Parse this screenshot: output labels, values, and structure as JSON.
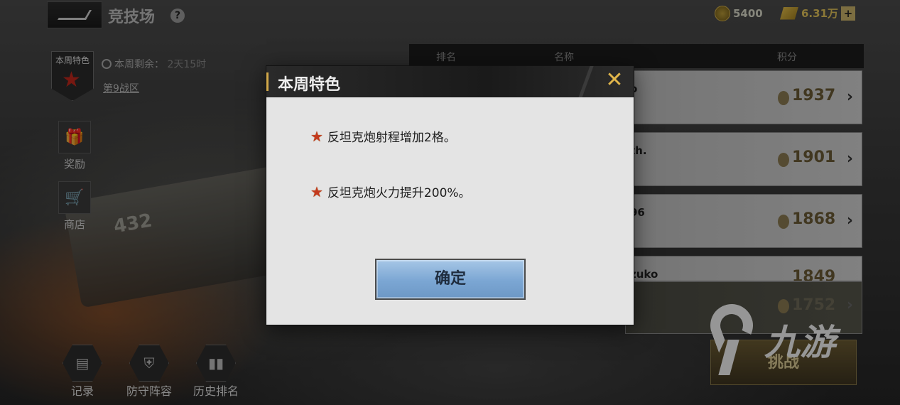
{
  "header": {
    "title": "竞技场",
    "help_icon": "?",
    "currency_1": "5400",
    "currency_2": "6.31万",
    "plus": "+"
  },
  "weekly": {
    "badge_label": "本周特色",
    "remaining_label": "本周剩余：",
    "remaining_value": "2天15时",
    "zone": "第9战区"
  },
  "side_menu": [
    {
      "label": "奖励",
      "icon": "gift-icon"
    },
    {
      "label": "商店",
      "icon": "shop-icon"
    }
  ],
  "bottom_menu": [
    {
      "label": "记录",
      "icon": "record-icon"
    },
    {
      "label": "防守阵容",
      "icon": "shield-icon"
    },
    {
      "label": "历史排名",
      "icon": "bar-chart-icon"
    }
  ],
  "ranking": {
    "headers": [
      "排名",
      "名称",
      "积分"
    ],
    "rows": [
      {
        "name": "o",
        "score": "1937"
      },
      {
        "name": "th.",
        "score": "1901"
      },
      {
        "name": "96",
        "score": "1868"
      },
      {
        "name": "zuko",
        "score": "1849"
      },
      {
        "name": "",
        "score": "1752"
      }
    ]
  },
  "challenge_button": "挑战",
  "watermark": "九游",
  "tank_number": "432",
  "modal": {
    "title": "本周特色",
    "features": [
      "反坦克炮射程增加2格。",
      "反坦克炮火力提升200%。"
    ],
    "confirm": "确定",
    "close_glyph": "✕"
  },
  "colors": {
    "accent_gold": "#d2a94a",
    "confirm_blue": "#7ba6d3",
    "star_red": "#c43a1e"
  }
}
